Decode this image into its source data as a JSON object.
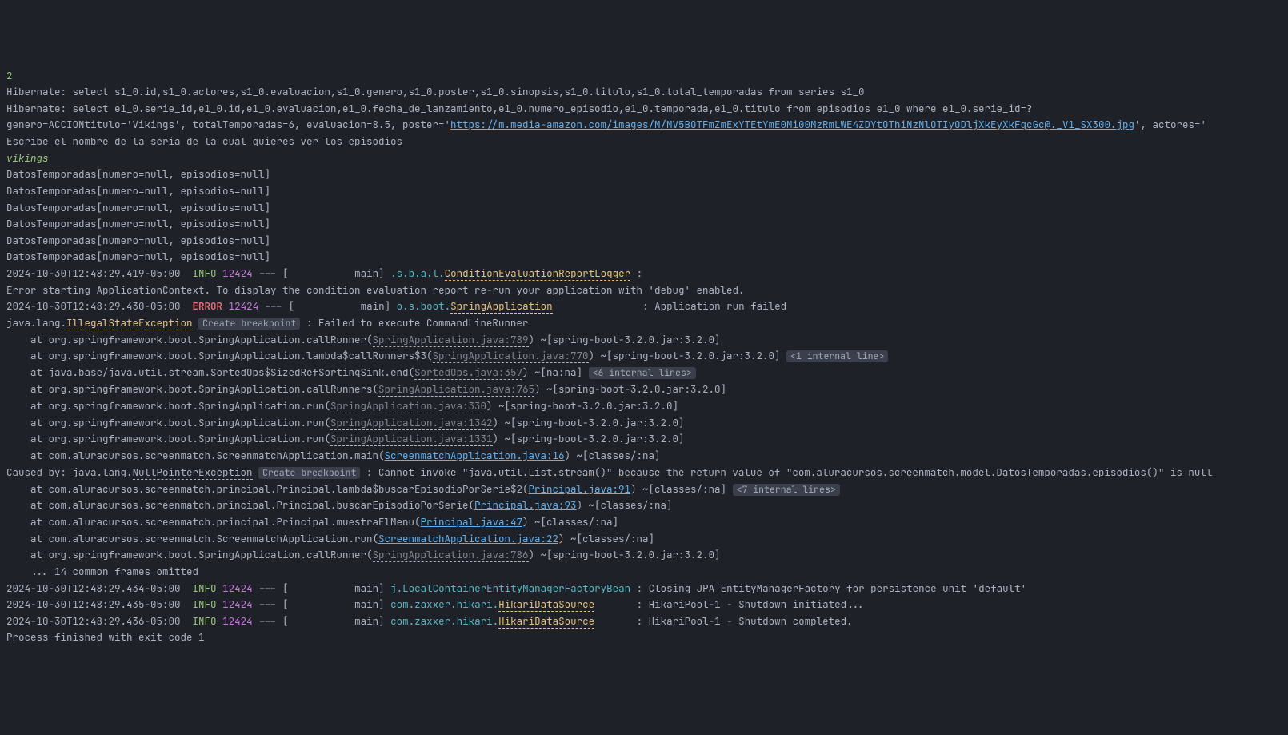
{
  "first_line_number": "2",
  "hibernate": {
    "q1": "Hibernate: select s1_0.id,s1_0.actores,s1_0.evaluacion,s1_0.genero,s1_0.poster,s1_0.sinopsis,s1_0.titulo,s1_0.total_temporadas from series s1_0",
    "q2": "Hibernate: select e1_0.serie_id,e1_0.id,e1_0.evaluacion,e1_0.fecha_de_lanzamiento,e1_0.numero_episodio,e1_0.temporada,e1_0.titulo from episodios e1_0 where e1_0.serie_id=?"
  },
  "serie_line": {
    "prefix": "genero=ACCIONtitulo='Vikings', totalTemporadas=6, evaluacion=8.5, poster='",
    "poster_url": "https://m.media-amazon.com/images/M/MV5BOTFmZmExYTEtYmE0Mi00MzRmLWE4ZDYtOThiNzNlOTIyODljXkEyXkFqcGc@._V1_SX300.jpg",
    "suffix": "', actores='"
  },
  "prompt": "Escribe el nombre de la seria de la cual quieres ver los episodios",
  "user_input": "vikings",
  "temporada_line": "DatosTemporadas[numero=null, episodios=null]",
  "temporada_count": 6,
  "log1": {
    "ts": "2024-10-30T12:48:29.419-05:00",
    "level": "INFO",
    "pid": "12424",
    "thread": "--- [           main] ",
    "logger_prefix": ".s.b.a.l.",
    "logger": "ConditionEvaluationReportLogger",
    "msg": " : "
  },
  "error_context": "Error starting ApplicationContext. To display the condition evaluation report re-run your application with 'debug' enabled.",
  "log2": {
    "ts": "2024-10-30T12:48:29.430-05:00",
    "level": "ERROR",
    "pid": "12424",
    "thread": "--- [           main] ",
    "logger_prefix": "o.s.boot.",
    "logger": "SpringApplication",
    "pad": "               ",
    "msg": ": Application run failed"
  },
  "exception": {
    "prefix": "java.lang.",
    "name": "IllegalStateException",
    "bp_chip": "Create breakpoint",
    "msg": " : Failed to execute CommandLineRunner"
  },
  "stack": [
    {
      "arrow": false,
      "pre": "    at org.springframework.boot.SpringApplication.callRunner(",
      "link": "SpringApplication.java:789",
      "post": ") ~[spring-boot-3.2.0.jar:3.2.0]",
      "chip": ""
    },
    {
      "arrow": true,
      "pre": "    at org.springframework.boot.SpringApplication.lambda$callRunners$3(",
      "link": "SpringApplication.java:770",
      "post": ") ~[spring-boot-3.2.0.jar:3.2.0]",
      "chip": "<1 internal line>"
    },
    {
      "arrow": true,
      "pre": "    at java.base/java.util.stream.SortedOps$SizedRefSortingSink.end(",
      "link": "SortedOps.java:357",
      "post": ") ~[na:na]",
      "chip": "<6 internal lines>"
    },
    {
      "arrow": false,
      "pre": "    at org.springframework.boot.SpringApplication.callRunners(",
      "link": "SpringApplication.java:765",
      "post": ") ~[spring-boot-3.2.0.jar:3.2.0]",
      "chip": ""
    },
    {
      "arrow": false,
      "pre": "    at org.springframework.boot.SpringApplication.run(",
      "link": "SpringApplication.java:330",
      "post": ") ~[spring-boot-3.2.0.jar:3.2.0]",
      "chip": ""
    },
    {
      "arrow": false,
      "pre": "    at org.springframework.boot.SpringApplication.run(",
      "link": "SpringApplication.java:1342",
      "post": ") ~[spring-boot-3.2.0.jar:3.2.0]",
      "chip": ""
    },
    {
      "arrow": false,
      "pre": "    at org.springframework.boot.SpringApplication.run(",
      "link": "SpringApplication.java:1331",
      "post": ") ~[spring-boot-3.2.0.jar:3.2.0]",
      "chip": ""
    },
    {
      "arrow": false,
      "pre": "    at com.aluracursos.screenmatch.ScreenmatchApplication.main(",
      "link": "ScreenmatchApplication.java:16",
      "link_strong": true,
      "post": ") ~[classes/:na]",
      "chip": ""
    }
  ],
  "caused_by": {
    "prefix": "Caused by: java.lang.",
    "name": "NullPointerException",
    "bp_chip": "Create breakpoint",
    "msg": " : Cannot invoke \"java.util.List.stream()\" because the return value of \"com.aluracursos.screenmatch.model.DatosTemporadas.episodios()\" is null"
  },
  "stack2": [
    {
      "arrow": true,
      "pre": "    at com.aluracursos.screenmatch.principal.Principal.lambda$buscarEpisodioPorSerie$2(",
      "link": "Principal.java:91",
      "link_strong": true,
      "post": ") ~[classes/:na]",
      "chip": "<7 internal lines>"
    },
    {
      "arrow": false,
      "pre": "    at com.aluracursos.screenmatch.principal.Principal.buscarEpisodioPorSerie(",
      "link": "Principal.java:93",
      "link_strong": true,
      "post": ") ~[classes/:na]",
      "chip": ""
    },
    {
      "arrow": false,
      "pre": "    at com.aluracursos.screenmatch.principal.Principal.muestraElMenu(",
      "link": "Principal.java:47",
      "link_strong": true,
      "post": ") ~[classes/:na]",
      "chip": ""
    },
    {
      "arrow": false,
      "pre": "    at com.aluracursos.screenmatch.ScreenmatchApplication.run(",
      "link": "ScreenmatchApplication.java:22",
      "link_strong": true,
      "post": ") ~[classes/:na]",
      "chip": ""
    },
    {
      "arrow": false,
      "pre": "    at org.springframework.boot.SpringApplication.callRunner(",
      "link": "SpringApplication.java:786",
      "post": ") ~[spring-boot-3.2.0.jar:3.2.0]",
      "chip": ""
    }
  ],
  "omitted": "    ... 14 common frames omitted",
  "log3": {
    "ts": "2024-10-30T12:48:29.434-05:00",
    "level": "INFO",
    "pid": "12424",
    "thread": "--- [           main] ",
    "logger": "j.LocalContainerEntityManagerFactoryBean",
    "msg": " : Closing JPA EntityManagerFactory for persistence unit 'default'"
  },
  "log4": {
    "ts": "2024-10-30T12:48:29.435-05:00",
    "level": "INFO",
    "pid": "12424",
    "thread": "--- [           main] ",
    "logger_prefix": "com.zaxxer.hikari.",
    "logger": "HikariDataSource",
    "pad": "       ",
    "msg": ": HikariPool-1 - Shutdown initiated..."
  },
  "log5": {
    "ts": "2024-10-30T12:48:29.436-05:00",
    "level": "INFO",
    "pid": "12424",
    "thread": "--- [           main] ",
    "logger_prefix": "com.zaxxer.hikari.",
    "logger": "HikariDataSource",
    "pad": "       ",
    "msg": ": HikariPool-1 - Shutdown completed."
  },
  "exit": "Process finished with exit code 1"
}
